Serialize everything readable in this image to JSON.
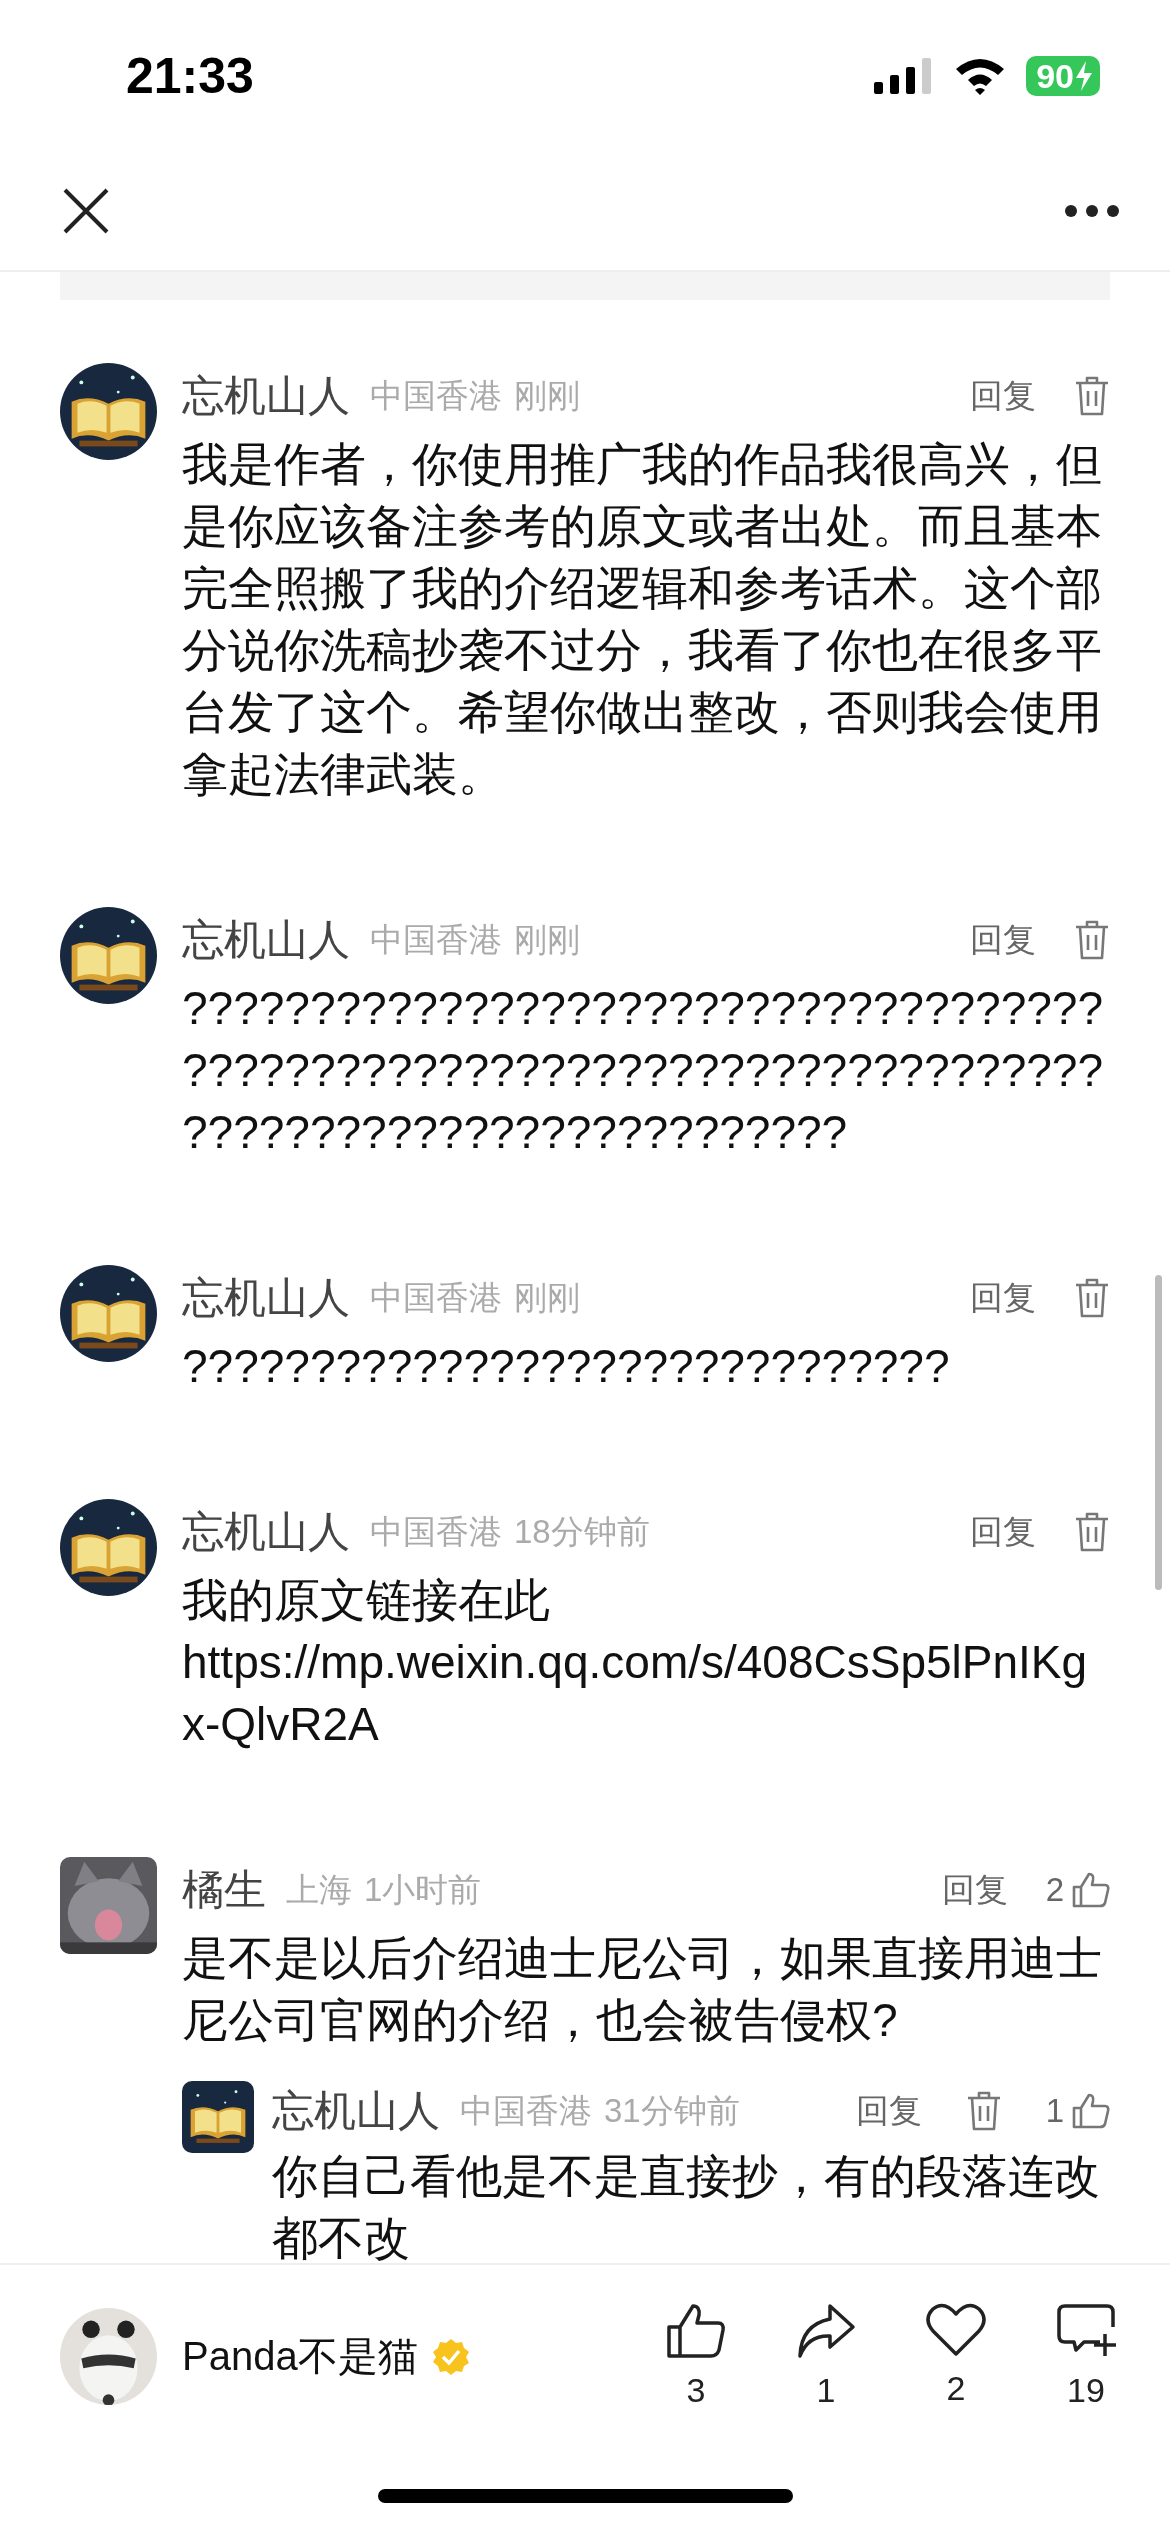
{
  "status_bar": {
    "time": "21:33",
    "battery": "90"
  },
  "comments": [
    {
      "kind": "comment",
      "author": "忘机山人",
      "location": "中国香港",
      "time": "刚刚",
      "reply_label": "回复",
      "deletable": true,
      "text": "我是作者，你使用推广我的作品我很高兴，但是你应该备注参考的原文或者出处。而且基本完全照搬了我的介绍逻辑和参考话术。这个部分说你洗稿抄袭不过分，我看了你也在很多平台发了这个。希望你做出整改，否则我会使用拿起法律武装。"
    },
    {
      "kind": "comment",
      "author": "忘机山人",
      "location": "中国香港",
      "time": "刚刚",
      "reply_label": "回复",
      "deletable": true,
      "text": "??????????????????????????????????????????????????????????????????????????????????????????????????"
    },
    {
      "kind": "comment",
      "author": "忘机山人",
      "location": "中国香港",
      "time": "刚刚",
      "reply_label": "回复",
      "deletable": true,
      "text": "??????????????????????????????"
    },
    {
      "kind": "comment",
      "author": "忘机山人",
      "location": "中国香港",
      "time": "18分钟前",
      "reply_label": "回复",
      "deletable": true,
      "text": "我的原文链接在此\nhttps://mp.weixin.qq.com/s/408CsSp5lPnIKgx-QlvR2A"
    },
    {
      "kind": "comment",
      "author": "橘生",
      "location": "上海",
      "time": "1小时前",
      "reply_label": "回复",
      "deletable": false,
      "likes": "2",
      "text": "是不是以后介绍迪士尼公司，如果直接用迪士尼公司官网的介绍，也会被告侵权?",
      "replies": [
        {
          "kind": "reply",
          "author": "忘机山人",
          "location": "中国香港",
          "time": "31分钟前",
          "reply_label": "回复",
          "deletable": true,
          "likes": "1",
          "text": "你自己看他是不是直接抄，有的段落连改都不改"
        }
      ]
    }
  ],
  "bottom_bar": {
    "author": "Panda不是猫",
    "verified": true,
    "actions": [
      {
        "kind": "like",
        "count": "3"
      },
      {
        "kind": "share",
        "count": "1"
      },
      {
        "kind": "favorite",
        "count": "2"
      },
      {
        "kind": "comment",
        "count": "19"
      }
    ]
  }
}
